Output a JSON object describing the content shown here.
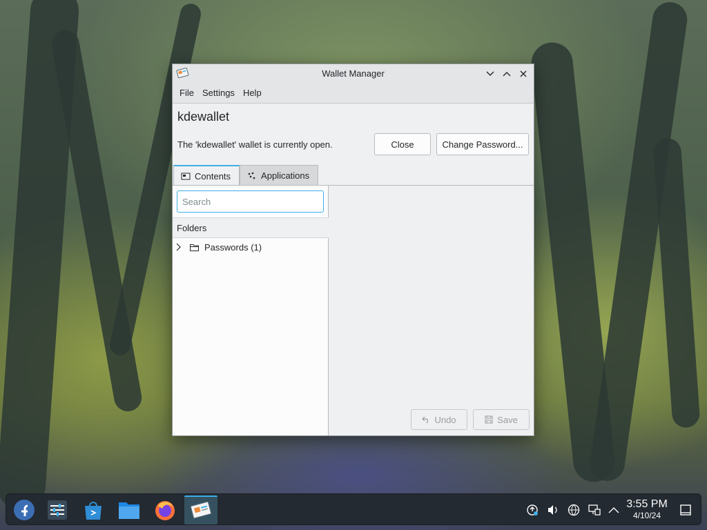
{
  "window": {
    "title": "Wallet Manager",
    "menu": [
      "File",
      "Settings",
      "Help"
    ],
    "wallet_name": "kdewallet",
    "status": "The 'kdewallet' wallet is currently open.",
    "close_label": "Close",
    "change_password_label": "Change Password...",
    "tabs": [
      {
        "label": "Contents",
        "icon": "wallet-icon",
        "active": true
      },
      {
        "label": "Applications",
        "icon": "applications-icon",
        "active": false
      }
    ],
    "search_placeholder": "Search",
    "search_value": "",
    "folders_header": "Folders",
    "folders": [
      {
        "label": "Passwords (1)",
        "icon": "folder-icon",
        "expanded": false
      }
    ],
    "undo_label": "Undo",
    "save_label": "Save"
  },
  "taskbar": {
    "apps": [
      {
        "name": "fedora-launcher-icon",
        "active": false
      },
      {
        "name": "system-settings-icon",
        "active": false
      },
      {
        "name": "discover-store-icon",
        "active": false
      },
      {
        "name": "file-manager-icon",
        "active": false
      },
      {
        "name": "firefox-icon",
        "active": false
      },
      {
        "name": "kwallet-manager-icon",
        "active": true
      }
    ],
    "tray": [
      "updates-icon",
      "volume-icon",
      "network-icon",
      "display-icon",
      "expand-tray-icon"
    ],
    "time": "3:55 PM",
    "date": "4/10/24"
  },
  "colors": {
    "accent": "#3daee9",
    "window_bg": "#eff0f1",
    "taskbar_bg": "#232a31"
  }
}
